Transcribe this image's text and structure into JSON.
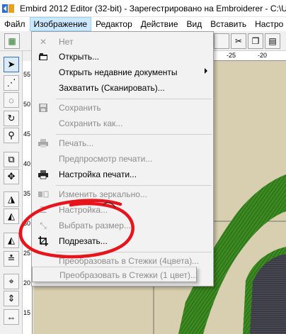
{
  "window": {
    "title": "Embird 2012 Editor (32-bit) - Зарегестрировано на Embroiderer - C:\\Use"
  },
  "menubar": {
    "items": [
      "Файл",
      "Изображение",
      "Редактор",
      "Действие",
      "Вид",
      "Вставить",
      "Настро"
    ]
  },
  "ruler": {
    "horizontal": [
      "-25",
      "-20"
    ],
    "vertical": [
      "55",
      "50",
      "45",
      "40",
      "35",
      "30",
      "25",
      "20",
      "15"
    ]
  },
  "menu": {
    "items": [
      {
        "label": "Нет",
        "icon": "x-icon",
        "disabled": true
      },
      {
        "label": "Открыть...",
        "icon": "open-icon",
        "disabled": false
      },
      {
        "label": "Открыть недавние документы",
        "icon": "",
        "disabled": false,
        "submenu": true
      },
      {
        "label": "Захватить (Сканировать)...",
        "icon": "",
        "disabled": false
      },
      {
        "label": "Сохранить",
        "icon": "save-icon",
        "disabled": true
      },
      {
        "label": "Сохранить как...",
        "icon": "",
        "disabled": true
      },
      {
        "label": "Печать...",
        "icon": "print-icon",
        "disabled": true
      },
      {
        "label": "Предпросмотр печати...",
        "icon": "",
        "disabled": true
      },
      {
        "label": "Настройка печати...",
        "icon": "print-setup-icon",
        "disabled": false
      },
      {
        "label": "Изменить зеркально...",
        "icon": "mirror-icon",
        "disabled": true
      },
      {
        "label": "Настройка...",
        "icon": "settings-icon",
        "disabled": true
      },
      {
        "label": "Выбрать размер...",
        "icon": "resize-icon",
        "disabled": true
      },
      {
        "label": "Подрезать...",
        "icon": "crop-icon",
        "disabled": false
      },
      {
        "label": "Преобразовать в Стежки (4цвета)...",
        "icon": "",
        "disabled": true
      },
      {
        "label": "Преобразовать в Стежки (1 цвет)...",
        "icon": "",
        "disabled": true
      }
    ]
  },
  "colors": {
    "canvas": "#d8cfb0",
    "stitch": "#2e7d1a",
    "annotation": "#e8141c",
    "highlight": "#cce8ff"
  }
}
